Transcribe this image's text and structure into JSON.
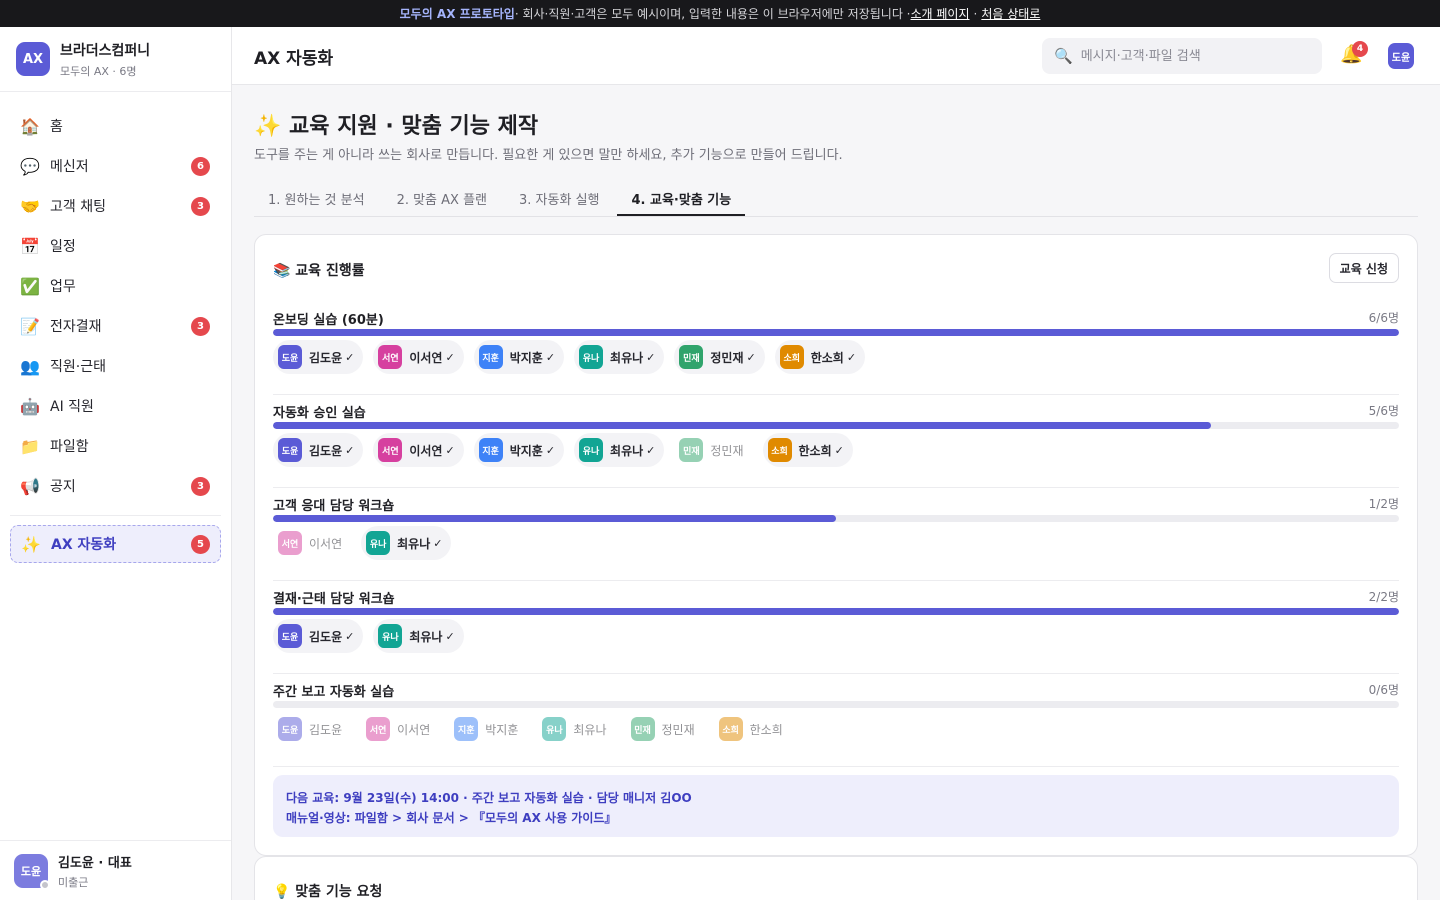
{
  "banner": {
    "highlight": "모두의 AX 프로토타입",
    "text": " · 회사·직원·고객은 모두 예시이며, 입력한 내용은 이 브라우저에만 저장됩니다 · ",
    "link_intro": "소개 페이지",
    "separator": "·",
    "link_reset": "처음 상태로"
  },
  "brand": {
    "logo": "AX",
    "name": "브라더스컴퍼니",
    "sub": "모두의 AX · 6명"
  },
  "sidebar": {
    "items": [
      {
        "icon": "🏠",
        "icon_name": "home-icon",
        "label": "홈",
        "badge": ""
      },
      {
        "icon": "💬",
        "icon_name": "chat-bubble-icon",
        "label": "메신저",
        "badge": "6"
      },
      {
        "icon": "🤝",
        "icon_name": "handshake-icon",
        "label": "고객 채팅",
        "badge": "3"
      },
      {
        "icon": "📅",
        "icon_name": "calendar-icon",
        "label": "일정",
        "badge": ""
      },
      {
        "icon": "✅",
        "icon_name": "check-icon",
        "label": "업무",
        "badge": ""
      },
      {
        "icon": "📝",
        "icon_name": "memo-icon",
        "label": "전자결재",
        "badge": "3"
      },
      {
        "icon": "👥",
        "icon_name": "people-icon",
        "label": "직원·근태",
        "badge": ""
      },
      {
        "icon": "🤖",
        "icon_name": "robot-icon",
        "label": "AI 직원",
        "badge": ""
      },
      {
        "icon": "📁",
        "icon_name": "folder-icon",
        "label": "파일함",
        "badge": ""
      },
      {
        "icon": "📢",
        "icon_name": "megaphone-icon",
        "label": "공지",
        "badge": "3"
      }
    ],
    "active": {
      "icon": "✨",
      "icon_name": "sparkles-icon",
      "label": "AX 자동화",
      "badge": "5"
    }
  },
  "user": {
    "avatar": "도윤",
    "name": "김도윤 · 대표",
    "status": "미출근"
  },
  "topbar": {
    "title": "AX 자동화",
    "search_placeholder": "메시지·고객·파일 검색",
    "bell_badge": "4",
    "avatar": "도윤"
  },
  "page": {
    "title": "✨ 교육 지원 · 맞춤 기능 제작",
    "subtitle": "도구를 주는 게 아니라 쓰는 회사로 만듭니다. 필요한 게 있으면 말만 하세요, 추가 기능으로 만들어 드립니다.",
    "tabs": [
      {
        "label": "1. 원하는 것 분석",
        "active": false
      },
      {
        "label": "2. 맞춤 AX 플랜",
        "active": false
      },
      {
        "label": "3. 자동화 실행",
        "active": false
      },
      {
        "label": "4. 교육·맞춤 기능",
        "active": true
      }
    ]
  },
  "colors": {
    "accent": "#5b5bd6",
    "avatar_도윤": "#5b5bd6",
    "avatar_서연": "#d6409f",
    "avatar_지훈": "#3e82f7",
    "avatar_유나": "#12a594",
    "avatar_민재": "#30a46c",
    "avatar_소희": "#e08a00"
  },
  "education": {
    "title": "📚 교육 진행률",
    "apply_button": "교육 신청",
    "courses": [
      {
        "name": "온보딩 실습 (60분)",
        "count": "6/6명",
        "progress": 1.0,
        "people": [
          {
            "av": "도윤",
            "name": "김도윤",
            "done": true
          },
          {
            "av": "서연",
            "name": "이서연",
            "done": true
          },
          {
            "av": "지훈",
            "name": "박지훈",
            "done": true
          },
          {
            "av": "유나",
            "name": "최유나",
            "done": true
          },
          {
            "av": "민재",
            "name": "정민재",
            "done": true
          },
          {
            "av": "소희",
            "name": "한소희",
            "done": true
          }
        ]
      },
      {
        "name": "자동화 승인 실습",
        "count": "5/6명",
        "progress": 0.833,
        "people": [
          {
            "av": "도윤",
            "name": "김도윤",
            "done": true
          },
          {
            "av": "서연",
            "name": "이서연",
            "done": true
          },
          {
            "av": "지훈",
            "name": "박지훈",
            "done": true
          },
          {
            "av": "유나",
            "name": "최유나",
            "done": true
          },
          {
            "av": "민재",
            "name": "정민재",
            "done": false
          },
          {
            "av": "소희",
            "name": "한소희",
            "done": true
          }
        ]
      },
      {
        "name": "고객 응대 담당 워크숍",
        "count": "1/2명",
        "progress": 0.5,
        "people": [
          {
            "av": "서연",
            "name": "이서연",
            "done": false
          },
          {
            "av": "유나",
            "name": "최유나",
            "done": true
          }
        ]
      },
      {
        "name": "결재·근태 담당 워크숍",
        "count": "2/2명",
        "progress": 1.0,
        "people": [
          {
            "av": "도윤",
            "name": "김도윤",
            "done": true
          },
          {
            "av": "유나",
            "name": "최유나",
            "done": true
          }
        ]
      },
      {
        "name": "주간 보고 자동화 실습",
        "count": "0/6명",
        "progress": 0.0,
        "people": [
          {
            "av": "도윤",
            "name": "김도윤",
            "done": false
          },
          {
            "av": "서연",
            "name": "이서연",
            "done": false
          },
          {
            "av": "지훈",
            "name": "박지훈",
            "done": false
          },
          {
            "av": "유나",
            "name": "최유나",
            "done": false
          },
          {
            "av": "민재",
            "name": "정민재",
            "done": false
          },
          {
            "av": "소희",
            "name": "한소희",
            "done": false
          }
        ]
      }
    ],
    "check_mark": "✓",
    "notice_line1": "다음 교육: 9월 23일(수) 14:00 · 주간 보고 자동화 실습 · 담당 매니저 김OO",
    "notice_line2": "매뉴얼·영상: 파일함 > 회사 문서 > 『모두의 AX 사용 가이드』"
  },
  "custom": {
    "title": "💡 맞춤 기능 요청"
  }
}
